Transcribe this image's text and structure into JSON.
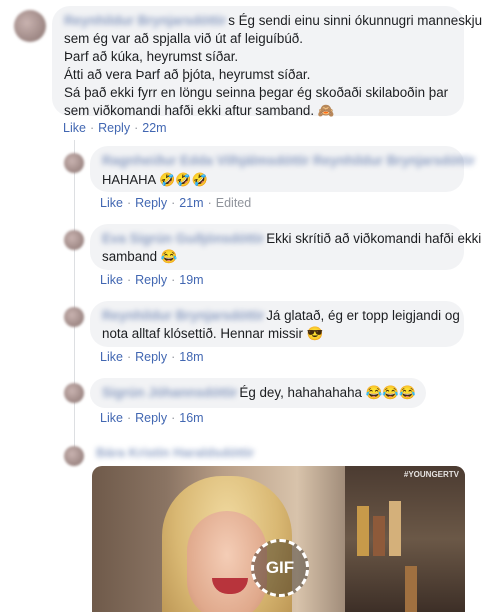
{
  "comments": [
    {
      "author": "Reynhildur Brynjarsdóttir",
      "lines": [
        "s Ég sendi einu sinni ókunnugri manneskju",
        "sem ég var að spjalla við út af leiguíbúð.",
        "Þarf að kúka, heyrumst síðar.",
        "Átti að vera Þarf að þjóta, heyrumst síðar.",
        "Sá það ekki fyrr en löngu seinna þegar ég skoðaði skilaboðin þar",
        "sem viðkomandi hafði ekki aftur samband. 🙈"
      ],
      "like": "Like",
      "reply": "Reply",
      "time": "22m",
      "edited": ""
    },
    {
      "author": "Ragnheiður Edda Vilhjálmsdóttir Reynhildur Brynjarsdóttir",
      "lines": [
        "HAHAHA 🤣🤣🤣"
      ],
      "like": "Like",
      "reply": "Reply",
      "time": "21m",
      "edited": "Edited"
    },
    {
      "author": "Eva Sigrún Guðjónsdóttir",
      "lines": [
        "Ekki skrítið að viðkomandi hafði ekki",
        "samband 😂"
      ],
      "like": "Like",
      "reply": "Reply",
      "time": "19m",
      "edited": ""
    },
    {
      "author": "Reynhildur Brynjarsdóttir",
      "lines": [
        "Já glatað, ég er topp leigjandi og",
        "nota alltaf klósettið. Hennar missir 😎"
      ],
      "like": "Like",
      "reply": "Reply",
      "time": "18m",
      "edited": ""
    },
    {
      "author": "Sigrún Jóhannsdóttir",
      "lines": [
        "Ég dey, hahahahaha 😂😂😂"
      ],
      "like": "Like",
      "reply": "Reply",
      "time": "16m",
      "edited": ""
    },
    {
      "author": "Bára Kristín Haraldsdóttir",
      "lines": [],
      "like": "",
      "reply": "",
      "time": "",
      "edited": ""
    }
  ],
  "gif": {
    "badge": "GIF",
    "watermark": "#YOUNGERTV"
  },
  "ui": {
    "separator": "·"
  },
  "colors": {
    "link": "#4267b2",
    "bubble": "#f2f3f5",
    "meta": "#90949c"
  }
}
